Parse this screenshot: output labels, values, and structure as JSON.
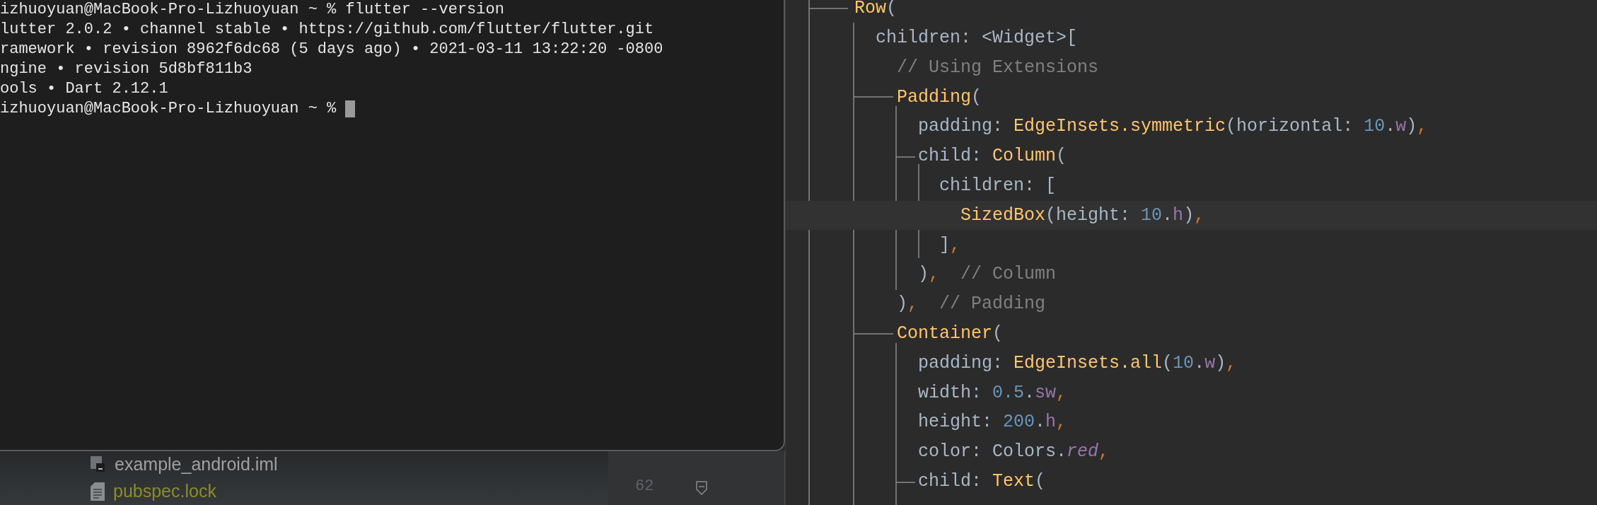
{
  "terminal": {
    "lines": [
      {
        "text": "izhuoyuan@MacBook-Pro-Lizhuoyuan ~ % flutter --version",
        "cursor": false
      },
      {
        "text": "lutter 2.0.2 • channel stable • https://github.com/flutter/flutter.git",
        "cursor": false
      },
      {
        "text": "ramework • revision 8962f6dc68 (5 days ago) • 2021-03-11 13:22:20 -0800",
        "cursor": false
      },
      {
        "text": "ngine • revision 5d8bf811b3",
        "cursor": false
      },
      {
        "text": "ools • Dart 2.12.1",
        "cursor": false
      },
      {
        "text": "izhuoyuan@MacBook-Pro-Lizhuoyuan ~ %",
        "cursor": true
      }
    ]
  },
  "project_tree": {
    "items": [
      {
        "label": "example_android.iml",
        "kind": "module"
      },
      {
        "label": "pubspec.lock",
        "kind": "file"
      }
    ]
  },
  "gutter": {
    "line_number": "62"
  },
  "editor": {
    "lines": [
      {
        "current": false,
        "tokens": [
          {
            "kind": "class",
            "text": "Row"
          },
          {
            "kind": "plain",
            "text": "("
          }
        ]
      },
      {
        "current": false,
        "tokens": [
          {
            "kind": "plain",
            "text": "  children: <Widget>["
          }
        ]
      },
      {
        "current": false,
        "tokens": [
          {
            "kind": "comment",
            "text": "    // Using Extensions"
          }
        ]
      },
      {
        "current": false,
        "tokens": [
          {
            "kind": "class",
            "text": "    Padding"
          },
          {
            "kind": "plain",
            "text": "("
          }
        ]
      },
      {
        "current": false,
        "tokens": [
          {
            "kind": "plain",
            "text": "      padding: "
          },
          {
            "kind": "class",
            "text": "EdgeInsets.symmetric"
          },
          {
            "kind": "plain",
            "text": "(horizontal: "
          },
          {
            "kind": "number",
            "text": "10"
          },
          {
            "kind": "plain",
            "text": "."
          },
          {
            "kind": "ext",
            "text": "w"
          },
          {
            "kind": "plain",
            "text": ")"
          },
          {
            "kind": "punct",
            "text": ","
          }
        ]
      },
      {
        "current": false,
        "tokens": [
          {
            "kind": "plain",
            "text": "      child: "
          },
          {
            "kind": "class",
            "text": "Column"
          },
          {
            "kind": "plain",
            "text": "("
          }
        ]
      },
      {
        "current": false,
        "tokens": [
          {
            "kind": "plain",
            "text": "        children: ["
          }
        ]
      },
      {
        "current": true,
        "tokens": [
          {
            "kind": "class",
            "text": "          SizedBox"
          },
          {
            "kind": "plain",
            "text": "(height: "
          },
          {
            "kind": "number",
            "text": "10"
          },
          {
            "kind": "plain",
            "text": "."
          },
          {
            "kind": "ext",
            "text": "h"
          },
          {
            "kind": "plain",
            "text": ")"
          },
          {
            "kind": "punct",
            "text": ","
          }
        ]
      },
      {
        "current": false,
        "tokens": [
          {
            "kind": "plain",
            "text": "        ]"
          },
          {
            "kind": "punct",
            "text": ","
          }
        ]
      },
      {
        "current": false,
        "tokens": [
          {
            "kind": "plain",
            "text": "      )"
          },
          {
            "kind": "punct",
            "text": ","
          },
          {
            "kind": "comment",
            "text": "  // Column"
          }
        ]
      },
      {
        "current": false,
        "tokens": [
          {
            "kind": "plain",
            "text": "    )"
          },
          {
            "kind": "punct",
            "text": ","
          },
          {
            "kind": "comment",
            "text": "  // Padding"
          }
        ]
      },
      {
        "current": false,
        "tokens": [
          {
            "kind": "class",
            "text": "    Container"
          },
          {
            "kind": "plain",
            "text": "("
          }
        ]
      },
      {
        "current": false,
        "tokens": [
          {
            "kind": "plain",
            "text": "      padding: "
          },
          {
            "kind": "class",
            "text": "EdgeInsets.all"
          },
          {
            "kind": "plain",
            "text": "("
          },
          {
            "kind": "number",
            "text": "10"
          },
          {
            "kind": "plain",
            "text": "."
          },
          {
            "kind": "ext",
            "text": "w"
          },
          {
            "kind": "plain",
            "text": ")"
          },
          {
            "kind": "punct",
            "text": ","
          }
        ]
      },
      {
        "current": false,
        "tokens": [
          {
            "kind": "plain",
            "text": "      width: "
          },
          {
            "kind": "number",
            "text": "0.5"
          },
          {
            "kind": "plain",
            "text": "."
          },
          {
            "kind": "ext",
            "text": "sw"
          },
          {
            "kind": "punct",
            "text": ","
          }
        ]
      },
      {
        "current": false,
        "tokens": [
          {
            "kind": "plain",
            "text": "      height: "
          },
          {
            "kind": "number",
            "text": "200"
          },
          {
            "kind": "plain",
            "text": "."
          },
          {
            "kind": "ext",
            "text": "h"
          },
          {
            "kind": "punct",
            "text": ","
          }
        ]
      },
      {
        "current": false,
        "tokens": [
          {
            "kind": "plain",
            "text": "      color: Colors."
          },
          {
            "kind": "ext_italic",
            "text": "red"
          },
          {
            "kind": "punct",
            "text": ","
          }
        ]
      },
      {
        "current": false,
        "tokens": [
          {
            "kind": "plain",
            "text": "      child: "
          },
          {
            "kind": "class",
            "text": "Text"
          },
          {
            "kind": "plain",
            "text": "("
          }
        ]
      }
    ]
  }
}
